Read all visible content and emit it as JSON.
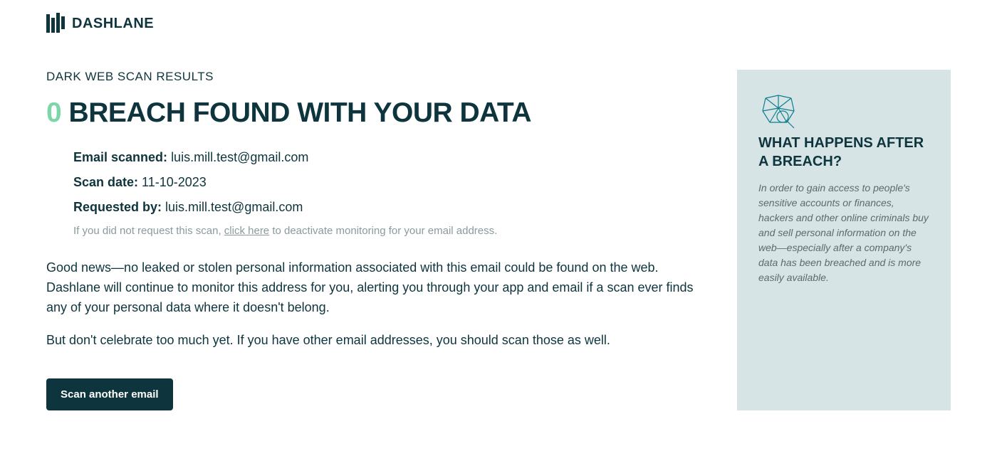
{
  "header": {
    "brand": "DASHLANE"
  },
  "main": {
    "section_label": "DARK WEB SCAN RESULTS",
    "result_count": "0",
    "result_title": "BREACH FOUND WITH YOUR DATA",
    "meta": {
      "email_scanned_label": "Email scanned:",
      "email_scanned_value": "luis.mill.test@gmail.com",
      "scan_date_label": "Scan date:",
      "scan_date_value": "11-10-2023",
      "requested_by_label": "Requested by:",
      "requested_by_value": "luis.mill.test@gmail.com"
    },
    "deactivate": {
      "prefix": "If you did not request this scan, ",
      "link": "click here",
      "suffix": " to deactivate monitoring for your email address."
    },
    "body_p1": "Good news—no leaked or stolen personal information associated with this email could be found on the web. Dashlane will continue to monitor this address for you, alerting you through your app and email if a scan ever finds any of your personal data where it doesn't belong.",
    "body_p2": "But don't celebrate too much yet. If you have other email addresses, you should scan those as well.",
    "scan_button": "Scan another email"
  },
  "sidebar": {
    "title": "WHAT HAPPENS AFTER A BREACH?",
    "body": "In order to gain access to people's sensitive accounts or finances, hackers and other online criminals buy and sell personal information on the web—especially after a company's data has been breached and is more easily available."
  }
}
